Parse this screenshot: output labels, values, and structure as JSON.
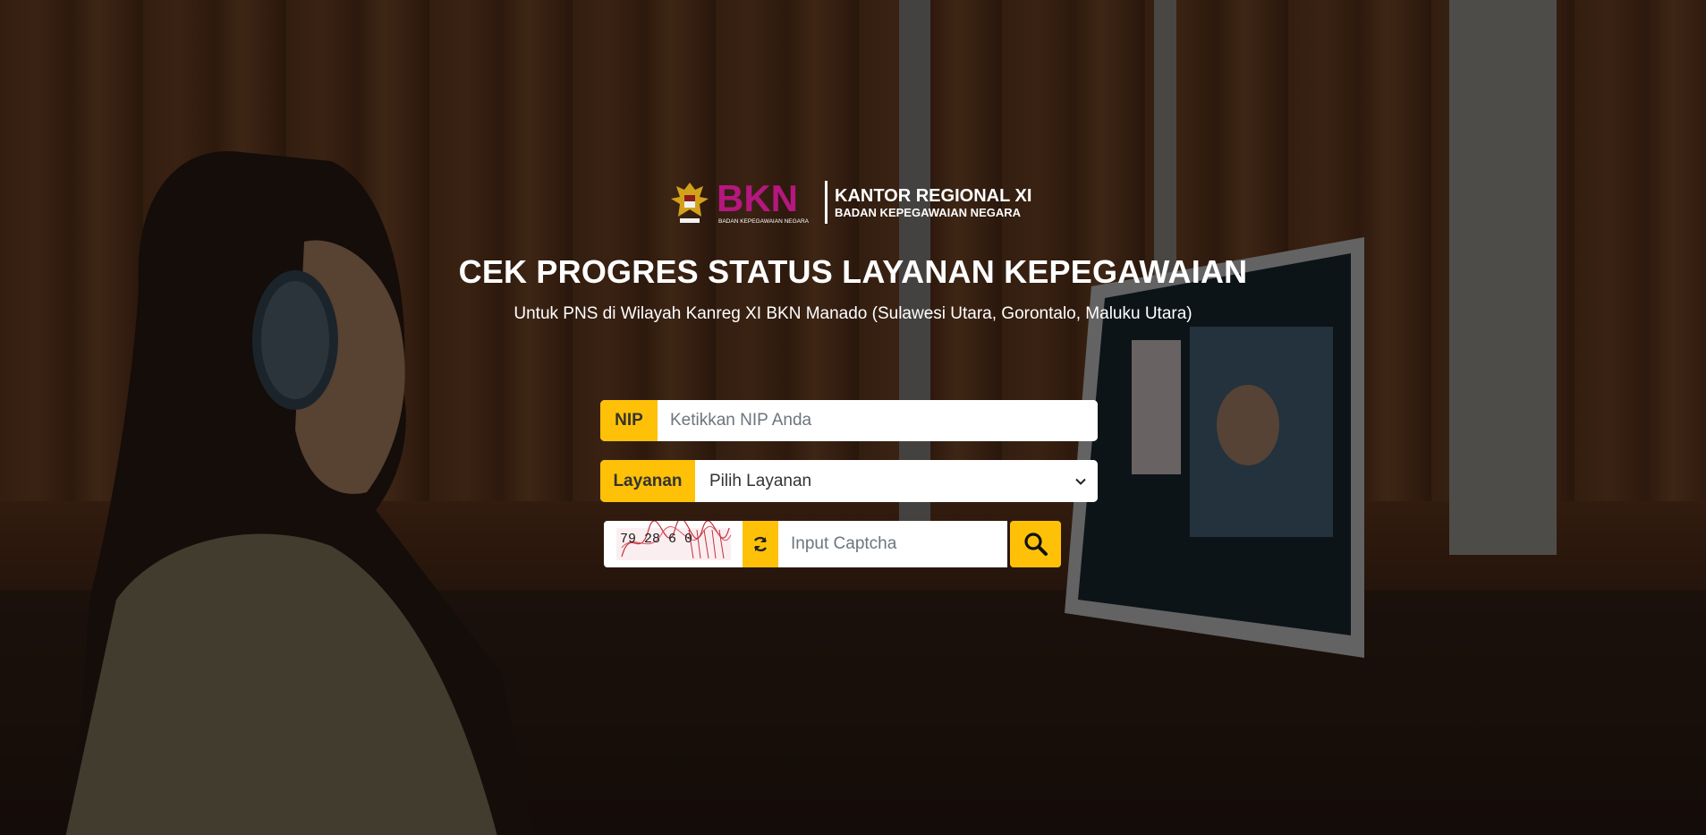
{
  "header": {
    "logo_text": "BKN",
    "logo_tagline": "BADAN KEPEGAWAIAN NEGARA",
    "office_line1": "KANTOR REGIONAL XI",
    "office_line2": "BADAN KEPEGAWAIAN NEGARA"
  },
  "main": {
    "title": "CEK PROGRES STATUS LAYANAN KEPEGAWAIAN",
    "subtitle": "Untuk PNS di Wilayah Kanreg XI BKN Manado (Sulawesi Utara, Gorontalo, Maluku Utara)"
  },
  "form": {
    "nip_label": "NIP",
    "nip_placeholder": "Ketikkan NIP Anda",
    "nip_value": "",
    "layanan_label": "Layanan",
    "layanan_selected": "Pilih Layanan",
    "captcha_text": "79 28 6 0",
    "captcha_placeholder": "Input Captcha",
    "captcha_value": ""
  },
  "icons": {
    "refresh": "refresh-icon",
    "search": "search-icon",
    "dropdown": "chevron-down-icon"
  },
  "colors": {
    "accent": "#ffc107",
    "logo_magenta": "#b5177f",
    "text_light": "#ffffff"
  }
}
